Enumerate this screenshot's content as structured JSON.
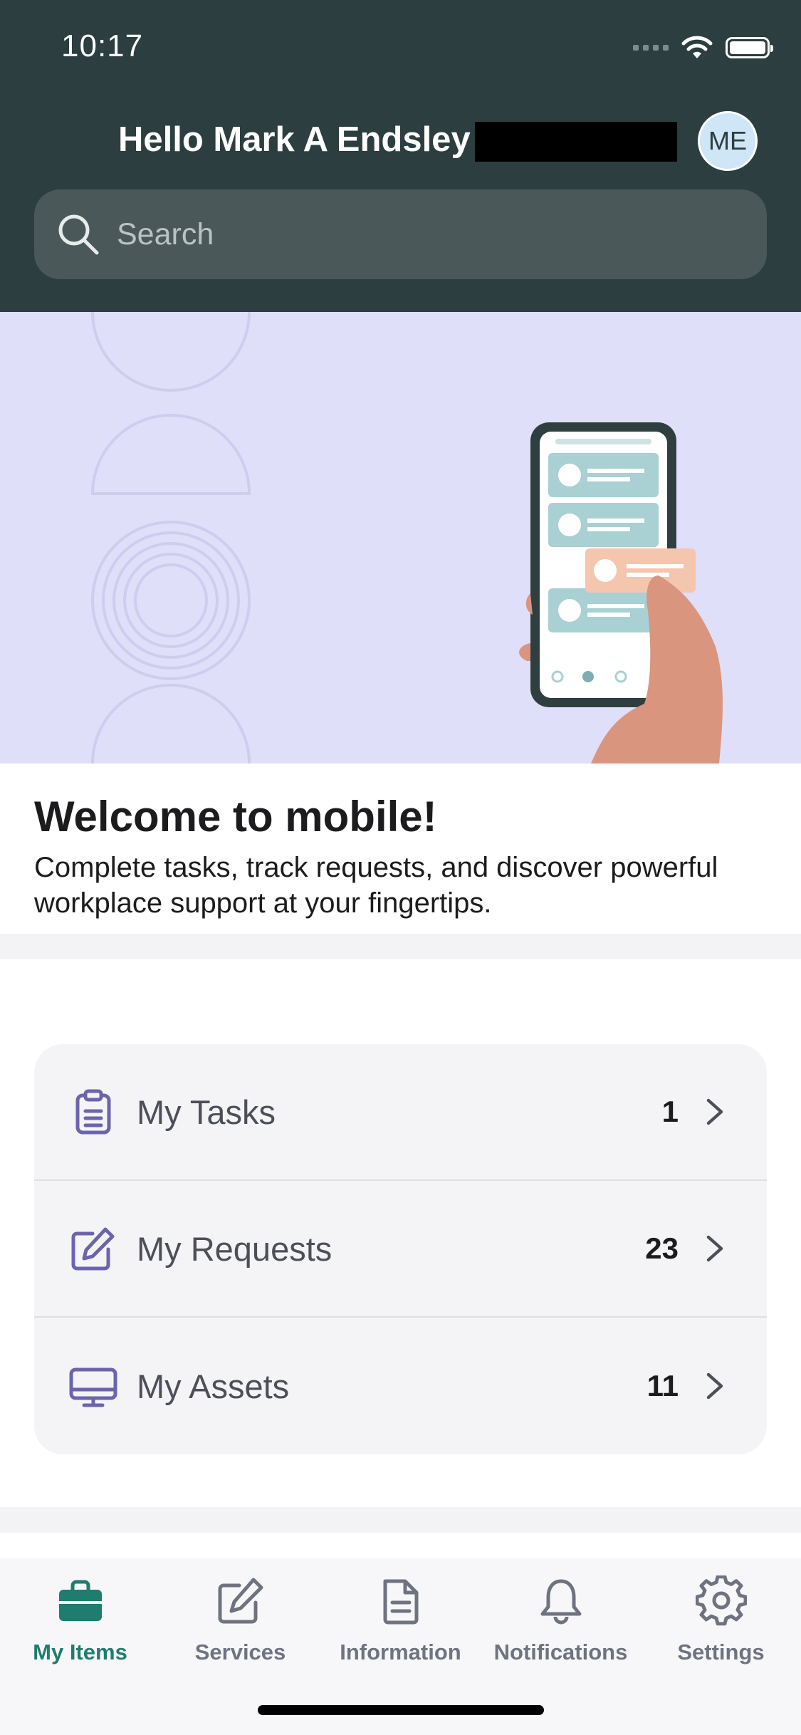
{
  "status_bar": {
    "time": "10:17"
  },
  "header": {
    "greeting": "Hello Mark A Endsley",
    "avatar_initials": "ME"
  },
  "search": {
    "placeholder": "Search"
  },
  "welcome": {
    "title": "Welcome to mobile!",
    "body": "Complete tasks, track requests, and discover powerful workplace support at your fingertips."
  },
  "items": [
    {
      "label": "My Tasks",
      "count": "1",
      "icon": "clipboard-icon"
    },
    {
      "label": "My Requests",
      "count": "23",
      "icon": "edit-icon"
    },
    {
      "label": "My Assets",
      "count": "11",
      "icon": "monitor-icon"
    }
  ],
  "tabs": [
    {
      "label": "My Items",
      "icon": "briefcase-icon",
      "active": true
    },
    {
      "label": "Services",
      "icon": "edit-icon"
    },
    {
      "label": "Information",
      "icon": "document-icon"
    },
    {
      "label": "Notifications",
      "icon": "bell-icon"
    },
    {
      "label": "Settings",
      "icon": "gear-icon"
    }
  ],
  "colors": {
    "header": "#2c3e3f",
    "banner": "#e0dffa",
    "accent": "#1f7d70",
    "icon_purple": "#6b64ad"
  }
}
